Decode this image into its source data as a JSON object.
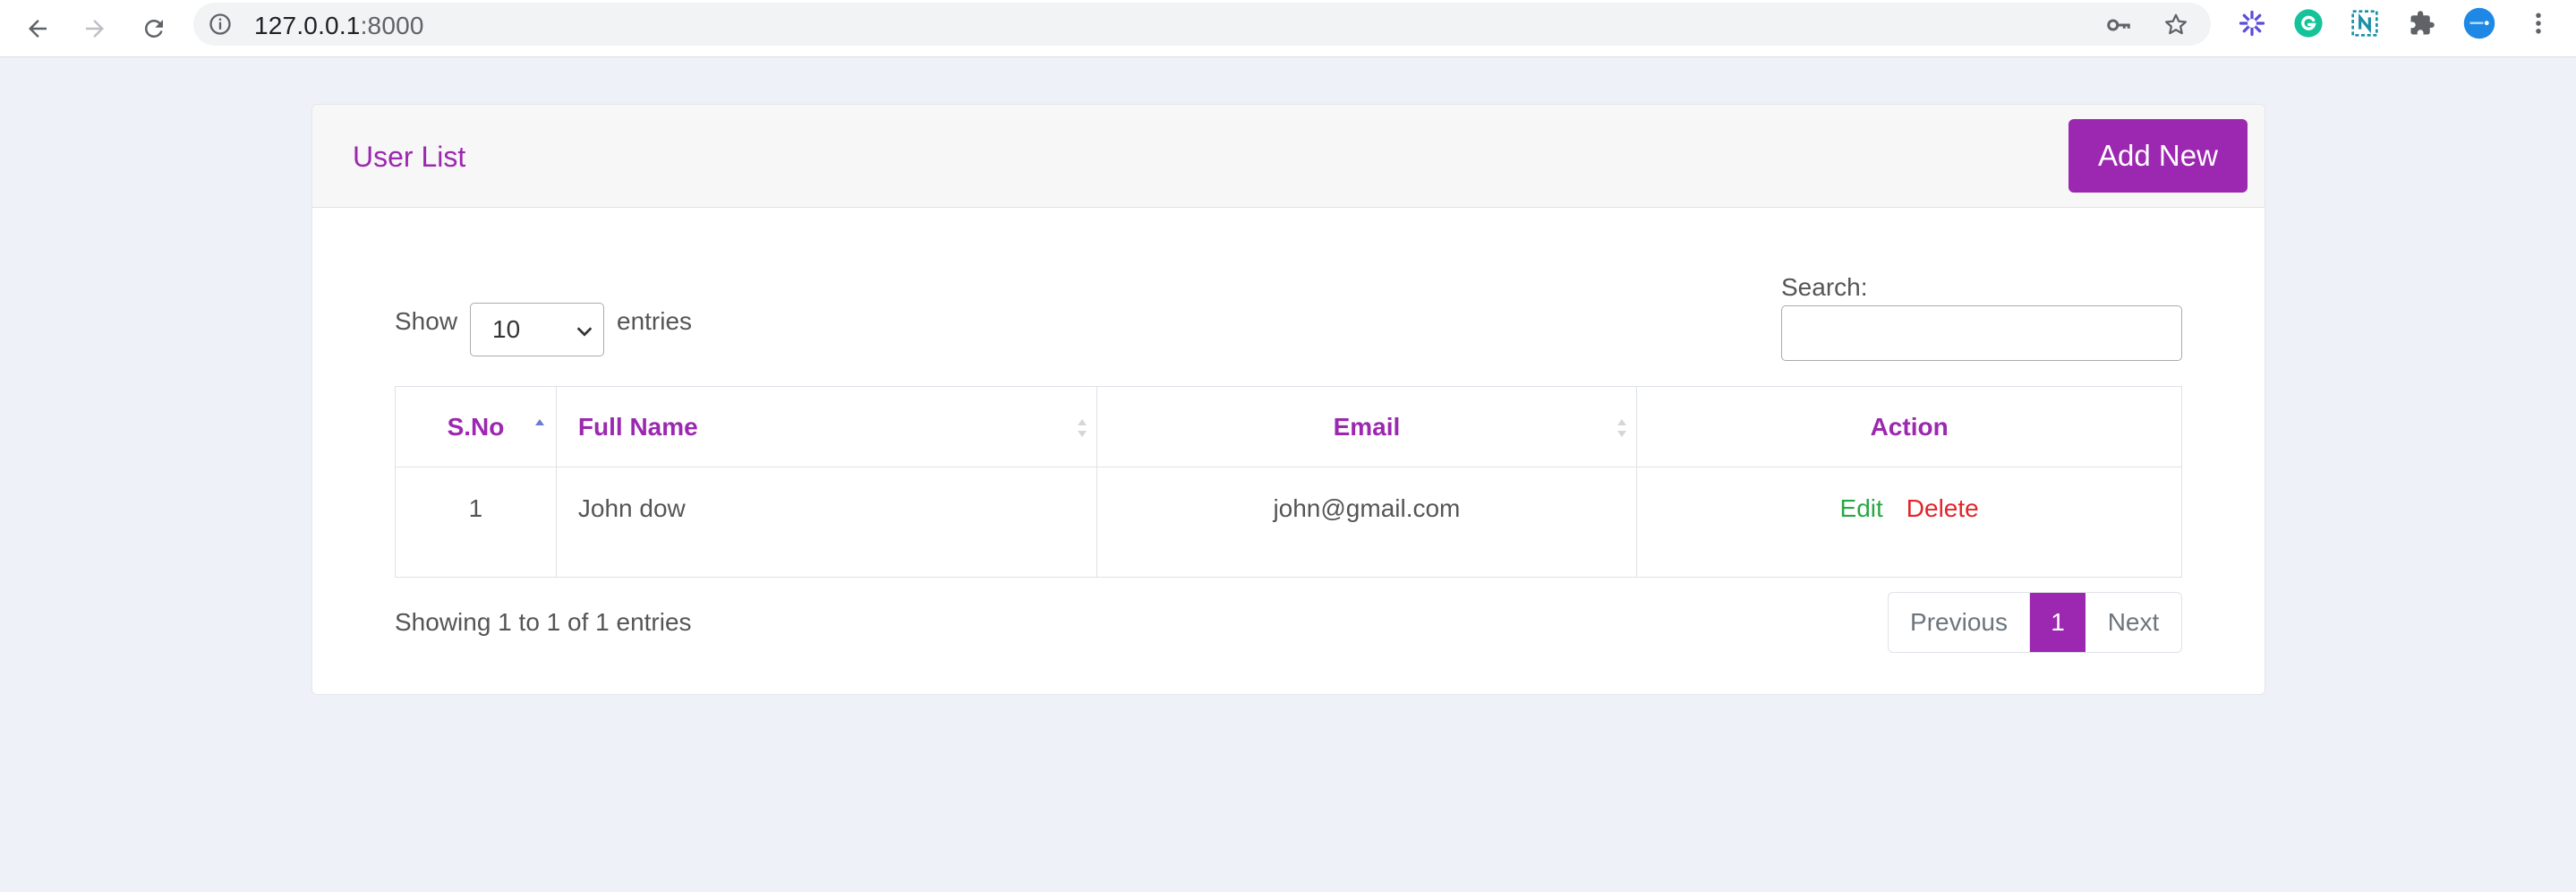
{
  "browser": {
    "url_host": "127.0.0.1",
    "url_port": ":8000",
    "extensions": [
      "asterisk-extension-icon",
      "grammarly-icon",
      "notion-clipper-icon",
      "puzzle-extensions-icon",
      "profile-avatar"
    ]
  },
  "card": {
    "title": "User List",
    "add_button": "Add New"
  },
  "controls": {
    "show_label": "Show",
    "entries_value": "10",
    "entries_label": "entries",
    "search_label": "Search:",
    "search_placeholder": ""
  },
  "table": {
    "headers": [
      "S.No",
      "Full Name",
      "Email",
      "Action"
    ],
    "rows": [
      {
        "sno": "1",
        "name": "John dow",
        "email": "john@gmail.com",
        "edit": "Edit",
        "delete": "Delete"
      }
    ]
  },
  "footer": {
    "info": "Showing 1 to 1 of 1 entries",
    "previous": "Previous",
    "current_page": "1",
    "next": "Next"
  },
  "colors": {
    "accent": "#9c27b0",
    "edit": "#28a745",
    "delete": "#e3242b",
    "background": "#eef1f7"
  }
}
